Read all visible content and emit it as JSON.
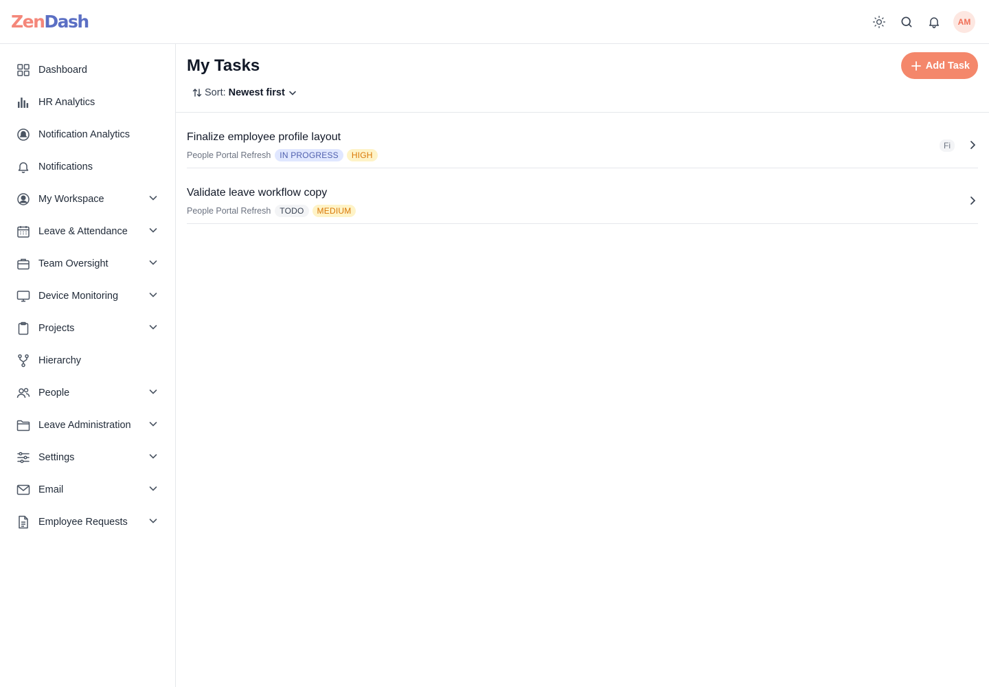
{
  "app": {
    "logo_part1": "Zen",
    "logo_part2": "Dash",
    "user_initials": "AM"
  },
  "topbar": {
    "icons": [
      "sun-icon",
      "search-icon",
      "bell-icon"
    ]
  },
  "sidebar": {
    "items": [
      {
        "label": "Dashboard",
        "icon": "grid-icon",
        "expandable": false
      },
      {
        "label": "HR Analytics",
        "icon": "bar-chart-icon",
        "expandable": false
      },
      {
        "label": "Notification Analytics",
        "icon": "notification-analytics-icon",
        "expandable": false
      },
      {
        "label": "Notifications",
        "icon": "bell-icon",
        "expandable": false
      },
      {
        "label": "My Workspace",
        "icon": "user-circle-icon",
        "expandable": true
      },
      {
        "label": "Leave & Attendance",
        "icon": "calendar-icon",
        "expandable": true
      },
      {
        "label": "Team Oversight",
        "icon": "briefcase-icon",
        "expandable": true
      },
      {
        "label": "Device Monitoring",
        "icon": "monitor-icon",
        "expandable": true
      },
      {
        "label": "Projects",
        "icon": "clipboard-icon",
        "expandable": true
      },
      {
        "label": "Hierarchy",
        "icon": "hierarchy-icon",
        "expandable": false
      },
      {
        "label": "People",
        "icon": "people-icon",
        "expandable": true
      },
      {
        "label": "Leave Administration",
        "icon": "folder-icon",
        "expandable": true
      },
      {
        "label": "Settings",
        "icon": "sliders-icon",
        "expandable": true
      },
      {
        "label": "Email",
        "icon": "mail-icon",
        "expandable": true
      },
      {
        "label": "Employee Requests",
        "icon": "document-icon",
        "expandable": true
      }
    ]
  },
  "main": {
    "title": "My Tasks",
    "add_button_label": "Add Task",
    "sort_label": "Sort:",
    "sort_value": "Newest first",
    "tasks": [
      {
        "title": "Finalize employee profile layout",
        "project": "People Portal Refresh",
        "status": "IN PROGRESS",
        "priority": "HIGH",
        "due": "Fi"
      },
      {
        "title": "Validate leave workflow copy",
        "project": "People Portal Refresh",
        "status": "TODO",
        "priority": "MEDIUM",
        "due": ""
      }
    ]
  },
  "colors": {
    "accent": "#f4876b",
    "logo_zen": "#f4877a",
    "logo_dash": "#5b6fc4",
    "in_progress_bg": "#e0e7ff",
    "priority_bg": "#fef3c7",
    "priority_text": "#d97706"
  }
}
